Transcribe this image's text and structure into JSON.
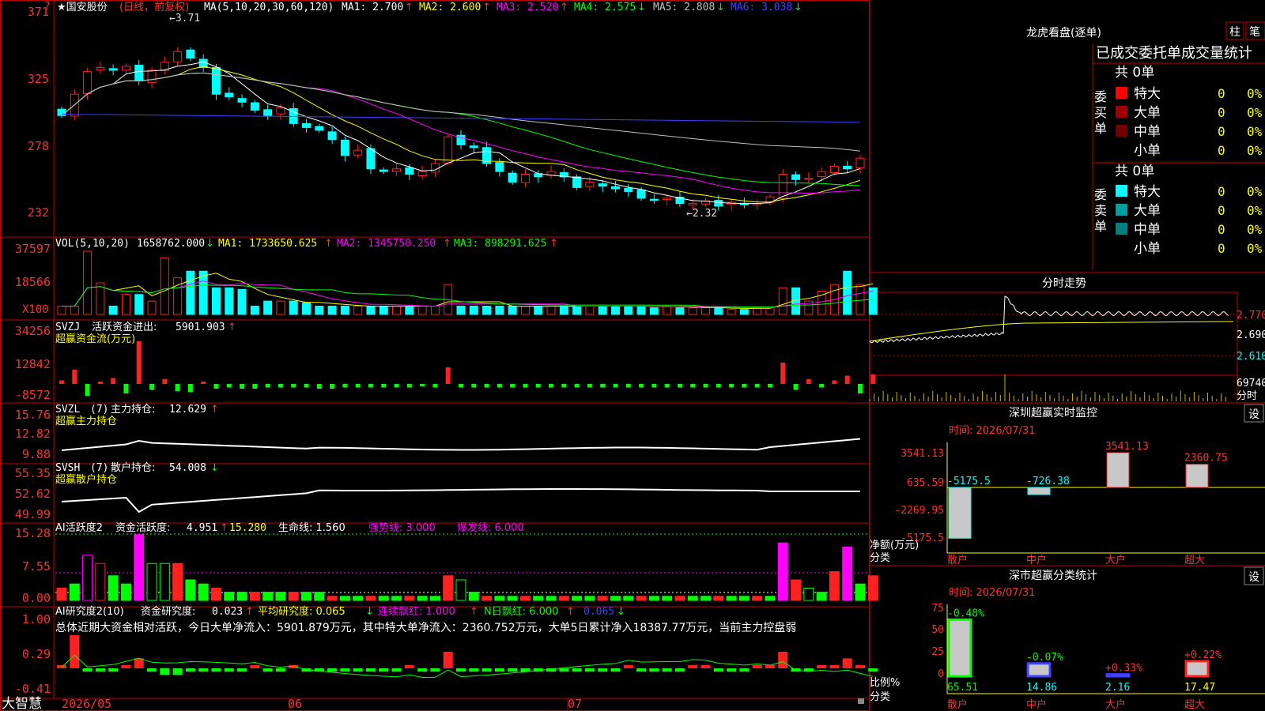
{
  "colors": {
    "up": "#ff2020",
    "down": "#00ffff",
    "frame": "#c00000",
    "ma1": "#ffffff",
    "ma2": "#ffff00",
    "ma3": "#ff00ff",
    "ma4": "#00ff00",
    "ma5": "#c0c0c0",
    "ma6": "#4040ff",
    "green_bar": "#00ff00",
    "magenta": "#ff00ff",
    "text_white": "#ffffff",
    "text_yellow": "#ffff00",
    "text_red": "#ff3030"
  },
  "header": {
    "stock_name": "★国安股份",
    "period": "(日线，前复权)",
    "ma_label": "MA(5,10,20,30,60,120)",
    "ma1": "MA1: 2.700",
    "ma2": "MA2: 2.600",
    "ma3": "MA3: 2.520",
    "ma4": "MA4: 2.575",
    "ma5": "MA5: 2.808",
    "ma6": "MA6: 3.038",
    "up_arrow": "↑",
    "down_arrow": "↓",
    "help": "?"
  },
  "price_panel": {
    "ticks": [
      "371",
      "325",
      "278",
      "232"
    ],
    "high_label": "3.71",
    "low_label": "←2.32",
    "ylim": [
      2.18,
      3.78
    ],
    "closes": [
      3.02,
      3.18,
      3.35,
      3.38,
      3.36,
      3.39,
      3.28,
      3.36,
      3.42,
      3.5,
      3.45,
      3.38,
      3.18,
      3.16,
      3.12,
      3.06,
      3.02,
      3.08,
      2.96,
      2.93,
      2.91,
      2.84,
      2.72,
      2.76,
      2.62,
      2.6,
      2.62,
      2.58,
      2.6,
      2.66,
      2.86,
      2.8,
      2.78,
      2.66,
      2.6,
      2.52,
      2.58,
      2.56,
      2.6,
      2.56,
      2.48,
      2.52,
      2.49,
      2.47,
      2.45,
      2.4,
      2.39,
      2.4,
      2.36,
      2.36,
      2.38,
      2.34,
      2.37,
      2.35,
      2.36,
      2.41,
      2.58,
      2.54,
      2.55,
      2.6,
      2.64,
      2.62,
      2.7
    ]
  },
  "vol_panel": {
    "title": "VOL(5,10,20)",
    "value": "1658762.000",
    "ma1": "MA1: 1733650.625",
    "ma2": "MA2: 1345750.250",
    "ma3": "MA3: 898291.625",
    "ticks": [
      "37597",
      "18566"
    ],
    "unit": "X100",
    "volumes": [
      5,
      5,
      38,
      19,
      5,
      12,
      12,
      8,
      34,
      22,
      26,
      26,
      16,
      16,
      15,
      5,
      8,
      8,
      8,
      7,
      5,
      5,
      5,
      5,
      5,
      5,
      5,
      5,
      5,
      5,
      18,
      5,
      5,
      5,
      5,
      5,
      5,
      5,
      5,
      5,
      5,
      5,
      5,
      5,
      5,
      5,
      4,
      5,
      4,
      4,
      4,
      4,
      3,
      3,
      4,
      4,
      16,
      16,
      8,
      14,
      18,
      26,
      18,
      16
    ]
  },
  "flow_panel": {
    "title": "SVZJ",
    "name": "活跃资金进出:",
    "value": "5901.903",
    "sub": "超赢资金流(万元)",
    "ticks": [
      "34256",
      "12842",
      "-8572"
    ],
    "bars": [
      3,
      12,
      -10,
      2,
      5,
      -8,
      36,
      -5,
      4,
      -6,
      -7,
      2,
      -4,
      -3,
      -4,
      -4,
      -3,
      -3,
      -3,
      -3,
      -4,
      -4,
      -3,
      -3,
      -3,
      -3,
      -3,
      -3,
      -2,
      -3,
      14,
      -3,
      -3,
      -3,
      -3,
      -3,
      -3,
      -3,
      -3,
      -3,
      -3,
      -3,
      -3,
      -3,
      -3,
      -3,
      -3,
      -3,
      -3,
      -3,
      -3,
      -3,
      -3,
      -3,
      -3,
      -3,
      18,
      -5,
      4,
      -3,
      3,
      7,
      -8,
      8
    ]
  },
  "main_hold_panel": {
    "title": "SVZL",
    "arg": "(7)",
    "name": "主力持仓:",
    "value": "12.629",
    "sub": "超赢主力持仓",
    "ticks": [
      "15.76",
      "12.82",
      "9.88"
    ]
  },
  "retail_panel": {
    "title": "SVSH",
    "arg": "(7)",
    "name": "散户持仓:",
    "value": "54.008",
    "sub": "超赢散户持仓",
    "ticks": [
      "55.35",
      "52.62",
      "49.99"
    ]
  },
  "active_panel": {
    "title": "AI活跃度2",
    "name": "资金活跃度:",
    "value": "4.951",
    "v2": "15.280",
    "life": "生命线: 1.560",
    "strong": "强势线: 3.000",
    "burst": "爆发线: 6.000",
    "ticks": [
      "15.28",
      "7.55",
      "0.00"
    ]
  },
  "research_panel": {
    "title": "AI研究度2(10)",
    "name": "资金研究度:",
    "value": "0.023",
    "avg": "平均研究度: 0.065",
    "red": "连续飘红: 1.000",
    "nred": "N日飘红: 6.000",
    "last": "0.065",
    "summary": "总体近期大资金相对活跃，今日大单净流入：5901.879万元，其中特大单净流入：2360.752万元，大单5日累计净入18387.77万元，当前主力控盘弱",
    "ticks": [
      "1.00",
      "0.29",
      "-0.41"
    ]
  },
  "footer": {
    "brand": "大智慧",
    "dates": [
      "2026/05",
      "06",
      "07"
    ]
  },
  "dragon_tiger": {
    "title": "龙虎看盘(逐单)",
    "btn1": "柱",
    "btn2": "笔",
    "header": "已成交委托单成交量统计",
    "buy_side": "委买单",
    "sell_side": "委卖单",
    "buy_total": "共 0单",
    "sell_total": "共 0单",
    "rows": [
      {
        "label": "特大",
        "count": "0",
        "pct": "0%"
      },
      {
        "label": "大单",
        "count": "0",
        "pct": "0%"
      },
      {
        "label": "中单",
        "count": "0",
        "pct": "0%"
      },
      {
        "label": "小单",
        "count": "0",
        "pct": "0%"
      }
    ]
  },
  "intraday": {
    "title": "分时走势",
    "p1": "2.770",
    "p2": "2.690",
    "p3": "2.610",
    "vol": "69740",
    "label": "分时"
  },
  "sz_monitor": {
    "title": "深圳超赢实时监控",
    "btn": "设",
    "time": "时间: 2026/07/31",
    "ticks": [
      "3541.13",
      "635.59",
      "-2269.95",
      "-5175.5"
    ],
    "ylabel": "净额(万元)",
    "xlabel": "分类",
    "categories": [
      "散户",
      "中户",
      "大户",
      "超大"
    ],
    "values": [
      -5175.5,
      -726.38,
      3541.13,
      2360.75
    ],
    "value_labels": [
      "-5175.5",
      "-726.38",
      "3541.13",
      "2360.75"
    ]
  },
  "sz_class": {
    "title": "深市超赢分类统计",
    "btn": "设",
    "time": "时间: 2026/07/31",
    "ticks": [
      "75",
      "50",
      "25",
      "0"
    ],
    "ylabel": "比例%",
    "xlabel": "分类",
    "categories": [
      "散户",
      "中户",
      "大户",
      "超大"
    ],
    "values": [
      65.51,
      14.86,
      2.16,
      17.47
    ],
    "value_labels": [
      "65.51",
      "14.86",
      "2.16",
      "17.47"
    ],
    "changes": [
      "-0.48%",
      "-0.07%",
      "+0.33%",
      "+0.22%"
    ]
  }
}
